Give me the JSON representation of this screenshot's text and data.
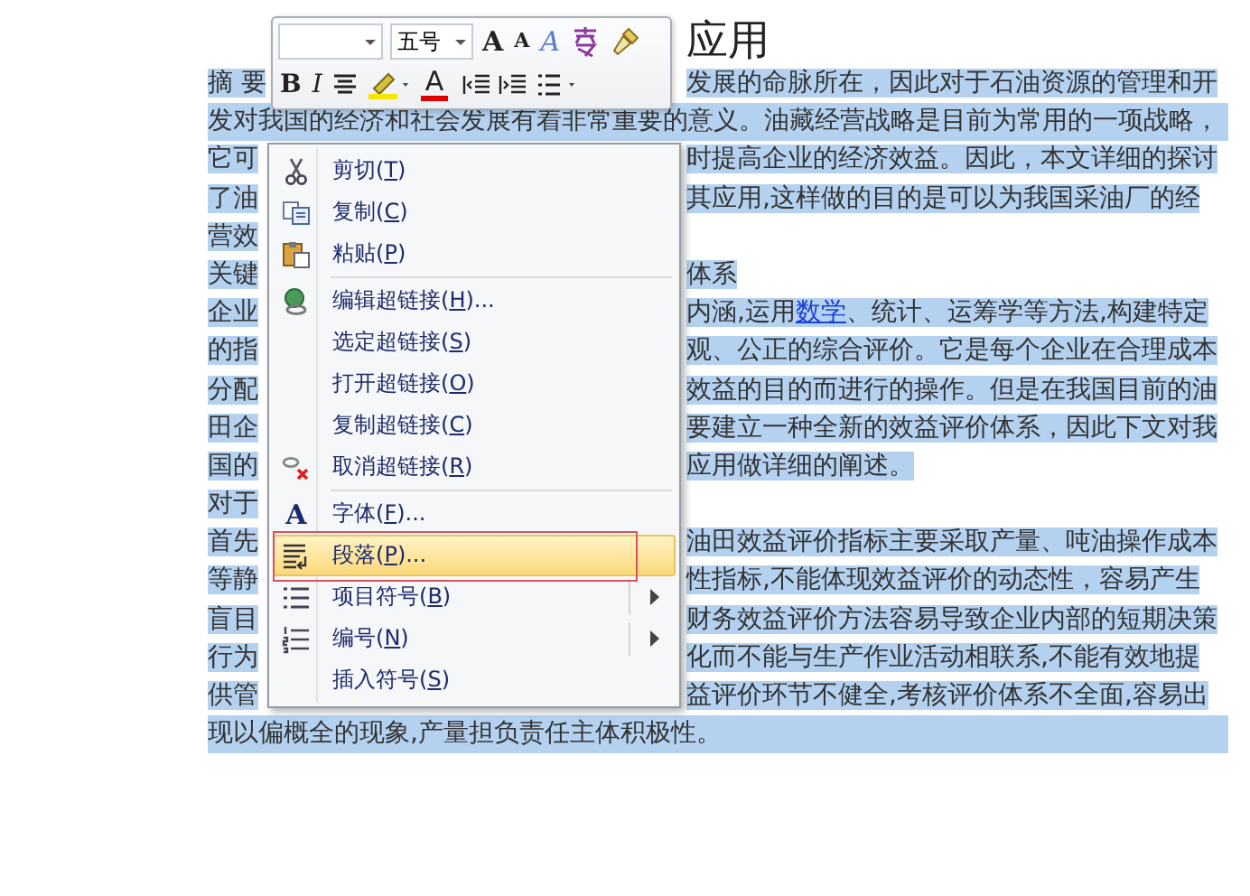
{
  "document": {
    "title": "应用",
    "lines": [
      {
        "kind": "split",
        "left": "摘 要",
        "right": [
          {
            "text": "发展的命脉所在，因此对于石油资源的管理和开"
          }
        ]
      },
      {
        "kind": "full",
        "text": "发对我国的经济和社会发展有着非常重要的意义。油藏经营战略是目前为常用的一项战略，"
      },
      {
        "kind": "split",
        "left": "它可",
        "right": [
          {
            "text": "时提高企业的经济效益。因此，本文详细的探讨"
          }
        ]
      },
      {
        "kind": "split",
        "left": "了油",
        "right": [
          {
            "text": "其应用,这样做的目的是可以为我国采油厂的经"
          }
        ]
      },
      {
        "kind": "split",
        "left": "营效"
      },
      {
        "kind": "split",
        "left": "关键",
        "right": [
          {
            "text": "体系"
          }
        ]
      },
      {
        "kind": "split",
        "left": "企业",
        "right": [
          {
            "text": "内涵,运用"
          },
          {
            "text": "数学",
            "link": true
          },
          {
            "text": "、统计、运筹学等方法,构建特定"
          }
        ]
      },
      {
        "kind": "split",
        "left": "的指",
        "right": [
          {
            "text": "观、公正的综合评价。它是每个企业在合理成本"
          }
        ]
      },
      {
        "kind": "split",
        "left": "分配",
        "right": [
          {
            "text": "效益的目的而进行的操作。但是在我国目前的油"
          }
        ]
      },
      {
        "kind": "split",
        "left": "田企",
        "right": [
          {
            "text": "要建立一种全新的效益评价体系，因此下文对我"
          }
        ]
      },
      {
        "kind": "split",
        "left": "国的",
        "right": [
          {
            "text": "应用做详细的阐述。"
          }
        ]
      },
      {
        "kind": "split",
        "left": "对于"
      },
      {
        "kind": "split",
        "left": "首先",
        "right": [
          {
            "text": "油田效益评价指标主要采取产量、吨油操作成本"
          }
        ]
      },
      {
        "kind": "split",
        "left": "等静",
        "right": [
          {
            "text": "性指标,不能体现效益评价的动态性，容易产生"
          }
        ]
      },
      {
        "kind": "split",
        "left": "盲目",
        "right": [
          {
            "text": "财务效益评价方法容易导致企业内部的短期决策"
          }
        ]
      },
      {
        "kind": "split",
        "left": "行为",
        "right": [
          {
            "text": "化而不能与生产作业活动相联系,不能有效地提"
          }
        ]
      },
      {
        "kind": "split",
        "left": "供管",
        "right": [
          {
            "text": "益评价环节不健全,考核评价体系不全面,容易出"
          }
        ]
      },
      {
        "kind": "full",
        "text": "现以偏概全的现象,产量担负责任主体积极性。"
      }
    ]
  },
  "mini_toolbar": {
    "font_controls": [
      {
        "kind": "font-field"
      },
      {
        "kind": "size-field",
        "value": "五号"
      },
      {
        "kind": "grow",
        "text": "A"
      },
      {
        "kind": "shrink",
        "text": "A"
      },
      {
        "kind": "style",
        "text": "A"
      },
      {
        "kind": "phonetic"
      },
      {
        "kind": "painter"
      }
    ],
    "format_buttons": [
      {
        "kind": "bold",
        "text": "B"
      },
      {
        "kind": "italic",
        "text": "I"
      },
      {
        "kind": "center"
      },
      {
        "kind": "highlight"
      },
      {
        "kind": "color",
        "text": "A"
      },
      {
        "kind": "outdent"
      },
      {
        "kind": "indent"
      },
      {
        "kind": "bullets"
      }
    ]
  },
  "context_menu": {
    "items": [
      {
        "kind": "cut",
        "before": "剪切(",
        "key": "T",
        "after": ")",
        "selected": false,
        "submenu": false
      },
      {
        "kind": "copy",
        "before": "复制(",
        "key": "C",
        "after": ")",
        "selected": false,
        "submenu": false
      },
      {
        "kind": "paste",
        "before": "粘贴(",
        "key": "P",
        "after": ")",
        "selected": false,
        "submenu": false
      },
      {
        "kind": "separator"
      },
      {
        "kind": "link",
        "before": "编辑超链接(",
        "key": "H",
        "after": ")...",
        "selected": false,
        "submenu": false
      },
      {
        "kind": "plain",
        "before": "选定超链接(",
        "key": "S",
        "after": ")",
        "selected": false,
        "submenu": false
      },
      {
        "kind": "plain",
        "before": "打开超链接(",
        "key": "O",
        "after": ")",
        "selected": false,
        "submenu": false
      },
      {
        "kind": "plain",
        "before": "复制超链接(",
        "key": "C",
        "after": ")",
        "selected": false,
        "submenu": false
      },
      {
        "kind": "unlink",
        "before": "取消超链接(",
        "key": "R",
        "after": ")",
        "selected": false,
        "submenu": false
      },
      {
        "kind": "separator"
      },
      {
        "kind": "font",
        "glyph": "A",
        "before": "字体(",
        "key": "F",
        "after": ")...",
        "selected": false,
        "submenu": false
      },
      {
        "kind": "paragraph",
        "before": "段落(",
        "key": "P",
        "after": ")...",
        "selected": true,
        "submenu": false
      },
      {
        "kind": "bullets",
        "before": "项目符号(",
        "key": "B",
        "after": ")",
        "selected": false,
        "submenu": true
      },
      {
        "kind": "numbering",
        "before": "编号(",
        "key": "N",
        "after": ")",
        "selected": false,
        "submenu": true
      },
      {
        "kind": "plain",
        "before": "插入符号(",
        "key": "S",
        "after": ")",
        "selected": false,
        "submenu": false
      }
    ]
  }
}
